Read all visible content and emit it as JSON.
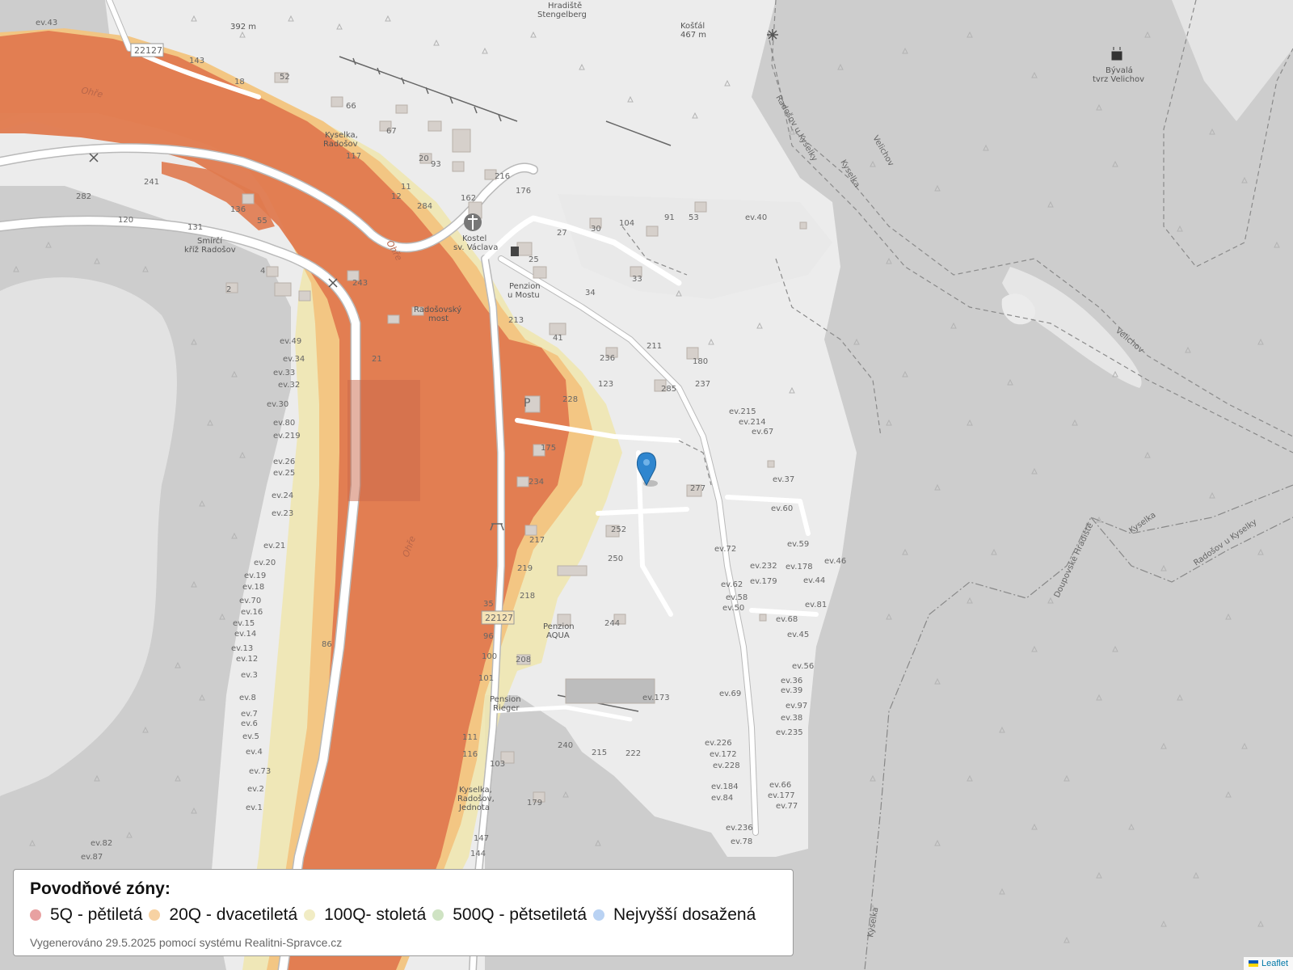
{
  "map": {
    "road_number": "22127",
    "river_name": "Ohře",
    "bridge_name": "Radošovský most",
    "labels": {
      "church": "Kostel sv. Václava",
      "pension_most": "Penzion u Mostu",
      "pension_aqua": "Penzion AQUA",
      "pension_rieger": "Pension Rieger",
      "kyselka_radosov": "Kyselka, Radošov",
      "bus_stop": "Kyselka, Radošov, Jednota",
      "cross": "Smírčí kříž Radošov",
      "hradiste": "Hradiště Stengelberg",
      "kostal": "Košťál",
      "kostal_elev": "467 m",
      "elev_392": "392 m",
      "velichov": "Bývalá tvrz Velichov",
      "path_radosov": "Radošov u Kyselky",
      "path_velichov": "Velichov",
      "path_kyselka": "Kyselka",
      "path_doupov": "Doupovské Hradiště"
    },
    "house_numbers": [
      "143",
      "18",
      "52",
      "66",
      "67",
      "20",
      "93",
      "10",
      "216",
      "176",
      "162",
      "27",
      "30",
      "104",
      "91",
      "53",
      "ev.40",
      "25",
      "33",
      "34",
      "213",
      "41",
      "211",
      "236",
      "180",
      "123",
      "237",
      "285",
      "175",
      "234",
      "277",
      "252",
      "250",
      "217",
      "219",
      "218",
      "244",
      "35",
      "96",
      "100",
      "208",
      "101",
      "111",
      "116",
      "103",
      "179",
      "147",
      "144",
      "240",
      "215",
      "222",
      "ev.173",
      "241",
      "282",
      "120",
      "131",
      "136",
      "55",
      "4",
      "2",
      "243",
      "ev.49",
      "ev.34",
      "ev.33",
      "ev.32",
      "ev.30",
      "ev.80",
      "ev.219",
      "ev.26",
      "ev.25",
      "ev.24",
      "ev.23",
      "ev.21",
      "ev.20",
      "ev.19",
      "ev.18",
      "ev.70",
      "ev.16",
      "ev.15",
      "ev.14",
      "ev.13",
      "ev.12",
      "ev.3",
      "ev.8",
      "ev.7",
      "ev.6",
      "ev.5",
      "ev.4",
      "ev.73",
      "ev.2",
      "ev.1",
      "ev.82",
      "ev.87",
      "ev.43",
      "ev.215",
      "ev.214",
      "ev.67",
      "ev.37",
      "ev.60",
      "ev.72",
      "ev.59",
      "ev.232",
      "ev.178",
      "ev.46",
      "ev.62",
      "ev.179",
      "ev.44",
      "ev.58",
      "ev.50",
      "ev.81",
      "ev.68",
      "ev.45",
      "ev.56",
      "ev.36",
      "ev.39",
      "ev.97",
      "ev.38",
      "ev.69",
      "ev.235",
      "ev.226",
      "ev.172",
      "ev.228",
      "ev.184",
      "ev.84",
      "ev.66",
      "ev.177",
      "ev.77",
      "ev.236",
      "ev.78",
      "284",
      "12",
      "11",
      "117",
      "21",
      "228",
      "86"
    ],
    "marker": "location-marker"
  },
  "legend": {
    "title": "Povodňové zóny:",
    "items": [
      {
        "label": "5Q - pětiletá",
        "color": "#e8a1a1"
      },
      {
        "label": "20Q - dvacetiletá",
        "color": "#f7d2a3"
      },
      {
        "label": "100Q- stoletá",
        "color": "#f1ecc4"
      },
      {
        "label": "500Q - pětsetiletá",
        "color": "#cfe3c3"
      },
      {
        "label": "Nejvyšší dosažená",
        "color": "#b9d2f3"
      }
    ],
    "footer": "Vygenerováno 29.5.2025 pomocí systému Realitni-Spravce.cz"
  },
  "attribution": {
    "text": "Leaflet"
  },
  "colors": {
    "zone_5q": "#e07a4f",
    "zone_20q": "#f2c47f",
    "zone_100q": "#efe7b1",
    "marker": "#2f86cf"
  }
}
